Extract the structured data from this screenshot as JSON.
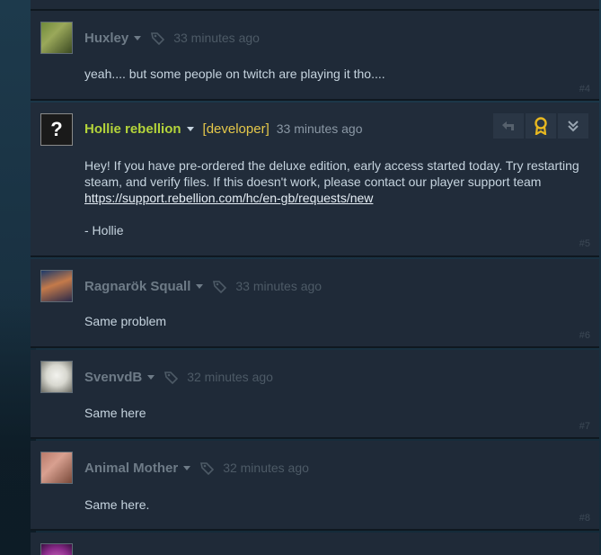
{
  "comments": [
    {
      "author": "Huxley",
      "time": "33 minutes ago",
      "text": "yeah.... but some people on twitch are playing it tho....",
      "number": "#4"
    },
    {
      "author": "Hollie rebellion",
      "dev_tag": "[developer]",
      "time": "33 minutes ago",
      "text_line1": "Hey! If you have pre-ordered the deluxe edition, early access started today. Try restarting steam, and verify files. If this doesn't work, please contact our player support team",
      "link": "https://support.rebellion.com/hc/en-gb/requests/new",
      "signature": "- Hollie",
      "number": "#5"
    },
    {
      "author": "Ragnarök Squall",
      "time": "33 minutes ago",
      "text": "Same problem",
      "number": "#6"
    },
    {
      "author": "SvenvdB",
      "time": "32 minutes ago",
      "text": "Same here",
      "number": "#7"
    },
    {
      "author": "Animal Mother",
      "time": "32 minutes ago",
      "text": "Same here.",
      "number": "#8"
    }
  ],
  "colors": {
    "developer_name": "#b4d43a",
    "developer_tag": "#e5c84a",
    "award_icon": "#e8b820"
  }
}
